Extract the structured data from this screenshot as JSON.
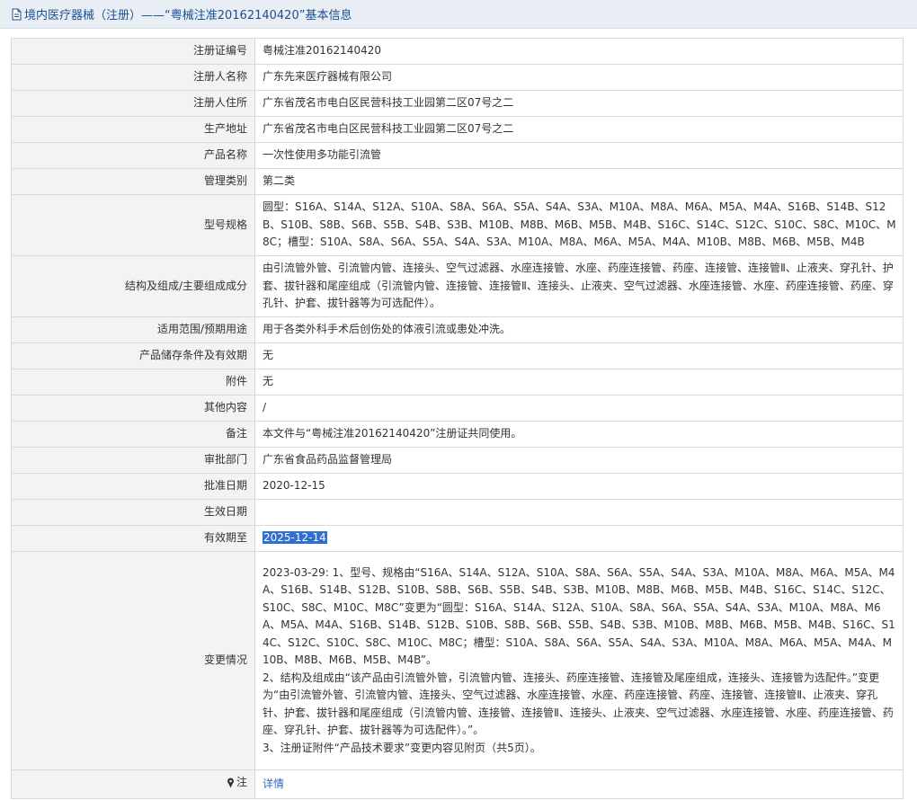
{
  "header": {
    "title": "境内医疗器械（注册）——“粤械注准20162140420”基本信息"
  },
  "rows": [
    {
      "label": "注册证编号",
      "value": "粤械注准20162140420"
    },
    {
      "label": "注册人名称",
      "value": "广东先来医疗器械有限公司"
    },
    {
      "label": "注册人住所",
      "value": "广东省茂名市电白区民营科技工业园第二区07号之二"
    },
    {
      "label": "生产地址",
      "value": "广东省茂名市电白区民营科技工业园第二区07号之二"
    },
    {
      "label": "产品名称",
      "value": "一次性使用多功能引流管"
    },
    {
      "label": "管理类别",
      "value": "第二类"
    },
    {
      "label": "型号规格",
      "value": "圆型：S16A、S14A、S12A、S10A、S8A、S6A、S5A、S4A、S3A、M10A、M8A、M6A、M5A、M4A、S16B、S14B、S12B、S10B、S8B、S6B、S5B、S4B、S3B、M10B、M8B、M6B、M5B、M4B、S16C、S14C、S12C、S10C、S8C、M10C、M8C；槽型：S10A、S8A、S6A、S5A、S4A、S3A、M10A、M8A、M6A、M5A、M4A、M10B、M8B、M6B、M5B、M4B"
    },
    {
      "label": "结构及组成/主要组成成分",
      "value": "由引流管外管、引流管内管、连接头、空气过滤器、水座连接管、水座、药座连接管、药座、连接管、连接管Ⅱ、止液夹、穿孔针、护套、拔针器和尾座组成（引流管内管、连接管、连接管Ⅱ、连接头、止液夹、空气过滤器、水座连接管、水座、药座连接管、药座、穿孔针、护套、拔针器等为可选配件）。"
    },
    {
      "label": "适用范围/预期用途",
      "value": "用于各类外科手术后创伤处的体液引流或患处冲洗。"
    },
    {
      "label": "产品储存条件及有效期",
      "value": "无"
    },
    {
      "label": "附件",
      "value": "无"
    },
    {
      "label": "其他内容",
      "value": "/"
    },
    {
      "label": "备注",
      "value": "本文件与“粤械注准20162140420”注册证共同使用。"
    },
    {
      "label": "审批部门",
      "value": "广东省食品药品监督管理局"
    },
    {
      "label": "批准日期",
      "value": "2020-12-15"
    },
    {
      "label": "生效日期",
      "value": ""
    },
    {
      "label": "有效期至",
      "value": "2025-12-14"
    }
  ],
  "changes": {
    "label": "变更情况",
    "lines": [
      "2023-03-29: 1、型号、规格由“S16A、S14A、S12A、S10A、S8A、S6A、S5A、S4A、S3A、M10A、M8A、M6A、M5A、M4A、S16B、S14B、S12B、S10B、S8B、S6B、S5B、S4B、S3B、M10B、M8B、M6B、M5B、M4B、S16C、S14C、S12C、S10C、S8C、M10C、M8C”变更为“圆型：S16A、S14A、S12A、S10A、S8A、S6A、S5A、S4A、S3A、M10A、M8A、M6A、M5A、M4A、S16B、S14B、S12B、S10B、S8B、S6B、S5B、S4B、S3B、M10B、M8B、M6B、M5B、M4B、S16C、S14C、S12C、S10C、S8C、M10C、M8C；槽型：S10A、S8A、S6A、S5A、S4A、S3A、M10A、M8A、M6A、M5A、M4A、M10B、M8B、M6B、M5B、M4B”。",
      "2、结构及组成由“该产品由引流管外管，引流管内管、连接头、药座连接管、连接管及尾座组成，连接头、连接管为选配件。”变更为“由引流管外管、引流管内管、连接头、空气过滤器、水座连接管、水座、药座连接管、药座、连接管、连接管Ⅱ、止液夹、穿孔针、护套、拔针器和尾座组成（引流管内管、连接管、连接管Ⅱ、连接头、止液夹、空气过滤器、水座连接管、水座、药座连接管、药座、穿孔针、护套、拔针器等为可选配件）。”。",
      "3、注册证附件“产品技术要求”变更内容见附页（共5页）。"
    ]
  },
  "note": {
    "label": "注",
    "link_label": "详情"
  },
  "colors": {
    "title_text": "#1a4f92",
    "title_bg": "#e9eef4",
    "label_bg": "#f3f3f3",
    "selection": "#2f6fd1",
    "link": "#2a6ebb"
  },
  "icons": {
    "title": "document-icon",
    "note": "pin-icon"
  }
}
